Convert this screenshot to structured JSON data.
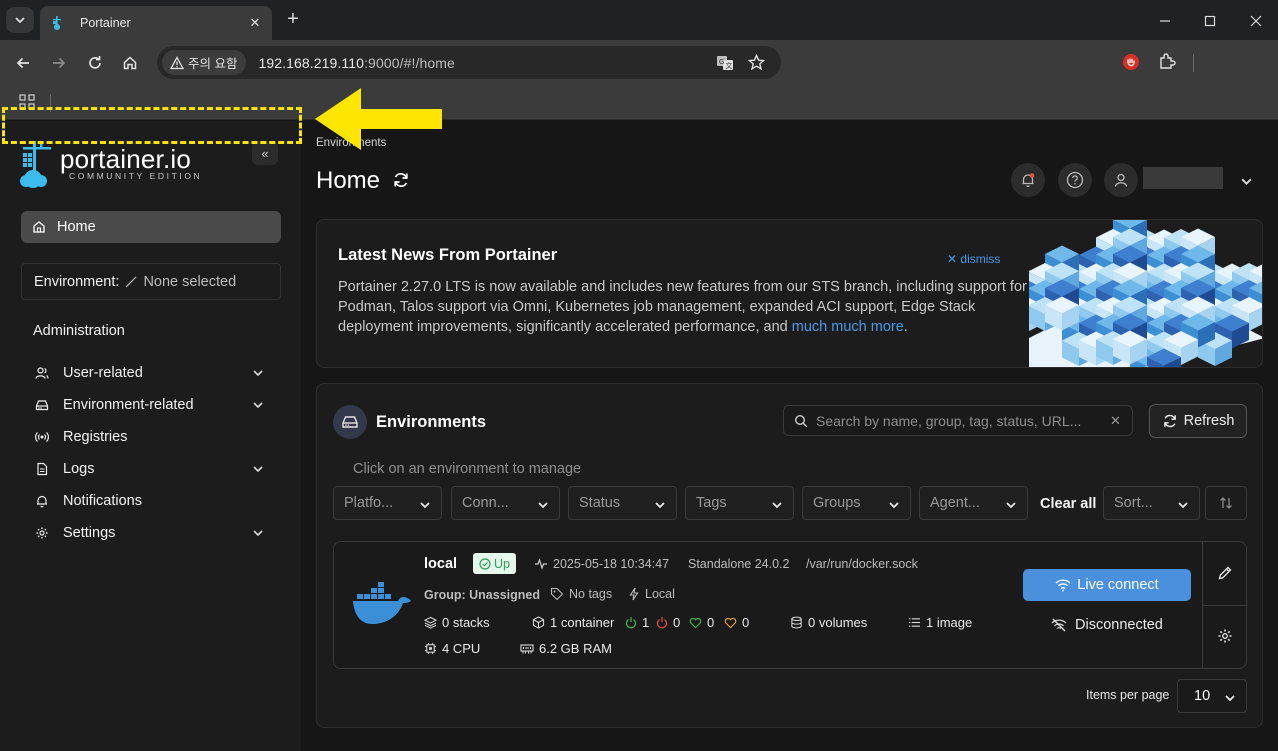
{
  "browser": {
    "tab_title": "Portainer",
    "security_label": "주의 요함",
    "url_host": "192.168.219.110",
    "url_rest": ":9000/#!/home",
    "icons": [
      "tab-search-icon",
      "portainer-favicon-icon",
      "close-tab-icon",
      "new-tab-icon",
      "minimize-icon",
      "maximize-icon",
      "close-window-icon",
      "back-icon",
      "forward-icon",
      "reload-icon",
      "home-icon",
      "warning-icon",
      "translate-icon",
      "star-icon",
      "extension-shield-icon",
      "extensions-icon",
      "apps-grid-icon"
    ]
  },
  "sidebar": {
    "logo_text": "portainer.io",
    "logo_subtitle": "COMMUNITY EDITION",
    "collapse_label": "«",
    "home_label": "Home",
    "environment_label": "Environment:",
    "environment_value": "None selected",
    "section_title": "Administration",
    "items": [
      {
        "label": "User-related",
        "icon": "user-icon",
        "expandable": true
      },
      {
        "label": "Environment-related",
        "icon": "drive-icon",
        "expandable": true
      },
      {
        "label": "Registries",
        "icon": "radio-icon",
        "expandable": false
      },
      {
        "label": "Logs",
        "icon": "file-icon",
        "expandable": true
      },
      {
        "label": "Notifications",
        "icon": "bell-icon",
        "expandable": false
      },
      {
        "label": "Settings",
        "icon": "gear-icon",
        "expandable": true
      }
    ]
  },
  "header": {
    "breadcrumb": "Environments",
    "title": "Home"
  },
  "news": {
    "title": "Latest News From Portainer",
    "dismiss_label": "dismiss",
    "body": "Portainer 2.27.0 LTS is now available and includes new features from our STS branch, including support for Podman, Talos support via Omni, Kubernetes job management, expanded ACI support, Edge Stack deployment improvements, significantly accelerated performance, and",
    "link_label": "much much more",
    "suffix": "."
  },
  "environments": {
    "title": "Environments",
    "search_placeholder": "Search by name, group, tag, status, URL...",
    "refresh_label": "Refresh",
    "hint": "Click on an environment to manage",
    "filters": [
      "Platfo...",
      "Conn...",
      "Status",
      "Tags",
      "Groups",
      "Agent..."
    ],
    "clear_all_label": "Clear all",
    "sort_label": "Sort...",
    "card": {
      "name": "local",
      "status": "Up",
      "timestamp": "2025-05-18 10:34:47",
      "engine": "Standalone 24.0.2",
      "socket": "/var/run/docker.sock",
      "group": "Group: Unassigned",
      "tags": "No tags",
      "locality": "Local",
      "stacks": "0 stacks",
      "containers": "1 container",
      "running": "1",
      "stopped": "0",
      "healthy": "0",
      "unhealthy": "0",
      "volumes": "0 volumes",
      "images": "1 image",
      "cpu": "4 CPU",
      "ram": "6.2 GB RAM",
      "live_connect_label": "Live connect",
      "connection_status": "Disconnected"
    },
    "items_per_page_label": "Items per page",
    "items_per_page_value": "10"
  },
  "colors": {
    "accent": "#4a90dc",
    "status_up": "#2e9e5a",
    "annotation": "#ffe600"
  }
}
